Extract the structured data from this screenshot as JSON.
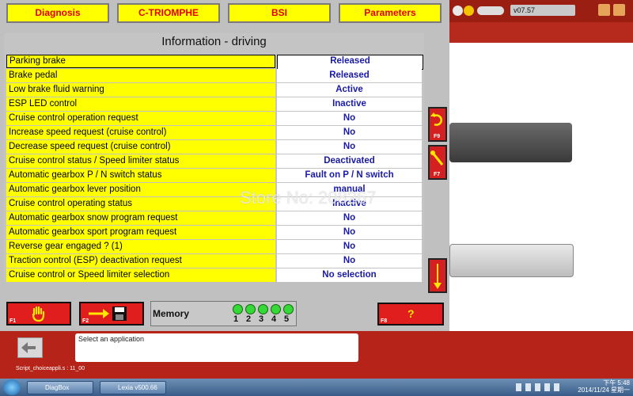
{
  "tabs": [
    "Diagnosis",
    "C-TRIOMPHE",
    "BSI",
    "Parameters"
  ],
  "panel": {
    "title": "Information - driving",
    "rows": [
      {
        "label": "Parking brake",
        "value": "Released"
      },
      {
        "label": "Brake pedal",
        "value": "Released"
      },
      {
        "label": "Low brake fluid warning",
        "value": "Active"
      },
      {
        "label": "ESP LED control",
        "value": "Inactive"
      },
      {
        "label": "Cruise control operation request",
        "value": "No"
      },
      {
        "label": "Increase speed request (cruise control)",
        "value": "No"
      },
      {
        "label": "Decrease speed request (cruise control)",
        "value": "No"
      },
      {
        "label": "Cruise control status / Speed limiter status",
        "value": "Deactivated"
      },
      {
        "label": "Automatic gearbox P / N switch status",
        "value": "Fault on P / N switch"
      },
      {
        "label": "Automatic gearbox lever position",
        "value": "manual"
      },
      {
        "label": "Cruise control operating status",
        "value": "Inactive"
      },
      {
        "label": "Automatic gearbox snow program request",
        "value": "No"
      },
      {
        "label": "Automatic gearbox sport program request",
        "value": "No"
      },
      {
        "label": "Reverse gear engaged ? (1)",
        "value": "No"
      },
      {
        "label": "Traction control (ESP) deactivation request",
        "value": "No"
      },
      {
        "label": "Cruise control or Speed limiter selection",
        "value": "No selection"
      }
    ]
  },
  "side_buttons": {
    "f9": "F9",
    "f7": "F7"
  },
  "bottom": {
    "f1": "F1",
    "f2": "F2",
    "f8": "F8",
    "f8_symbol": "?",
    "memory_label": "Memory",
    "memory_slots": [
      "1",
      "2",
      "3",
      "4",
      "5"
    ]
  },
  "background_app": {
    "version": "v07.57"
  },
  "status": {
    "message": "Select an application",
    "script": "Script_choiceappli.s : 11_00"
  },
  "watermark": "Store No: 208267",
  "taskbar": {
    "items": [
      "DiagBox",
      "Lexia v500.66"
    ],
    "clock_time": "下午 5:48",
    "clock_date": "2014/11/24 星期一"
  }
}
